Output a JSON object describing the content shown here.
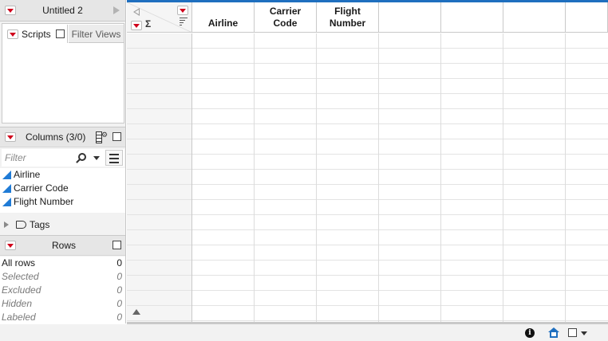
{
  "window": {
    "title": "Untitled 2"
  },
  "scripts_panel": {
    "tab_scripts": "Scripts",
    "tab_filter_views": "Filter Views"
  },
  "columns_panel": {
    "title": "Columns (3/0)",
    "filter_placeholder": "Filter",
    "items": [
      {
        "label": "Airline",
        "type_icon": "continuous-column-icon"
      },
      {
        "label": "Carrier Code",
        "type_icon": "continuous-column-icon"
      },
      {
        "label": "Flight Number",
        "type_icon": "continuous-column-icon"
      }
    ],
    "tags_label": "Tags"
  },
  "rows_panel": {
    "title": "Rows",
    "stats": [
      {
        "label": "All rows",
        "value": "0"
      },
      {
        "label": "Selected",
        "value": "0"
      },
      {
        "label": "Excluded",
        "value": "0"
      },
      {
        "label": "Hidden",
        "value": "0"
      },
      {
        "label": "Labeled",
        "value": "0"
      }
    ]
  },
  "table": {
    "corner_symbol": "Σ",
    "columns": [
      {
        "label": "Airline"
      },
      {
        "label": "Carrier\nCode"
      },
      {
        "label": "Flight\nNumber"
      },
      {
        "label": ""
      },
      {
        "label": ""
      },
      {
        "label": ""
      },
      {
        "label": ""
      }
    ]
  },
  "status_bar": {
    "info_icon": "info-icon",
    "home_icon": "home-icon"
  },
  "colors": {
    "accent": "#1f6fbf",
    "red_triangle": "#d0021b",
    "column_icon": "#1f7bd6"
  }
}
